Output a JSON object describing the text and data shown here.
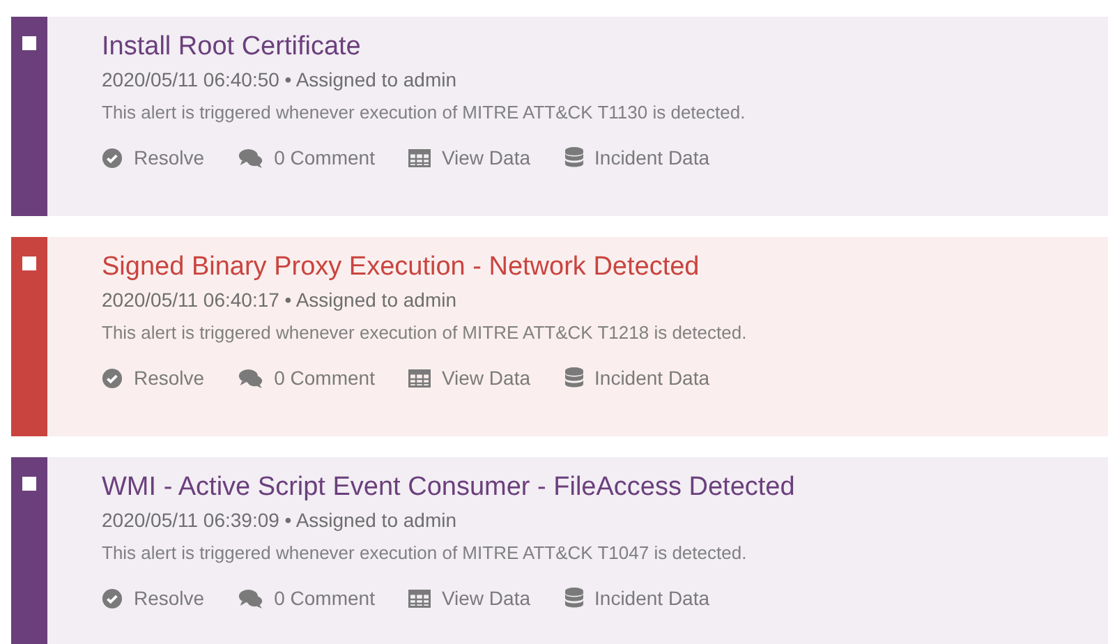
{
  "alerts": [
    {
      "title": "Install Root Certificate",
      "color": "#6b3f7c",
      "checked": false,
      "meta": "2020/05/11 06:40:50 • Assigned to admin",
      "description": "This alert is triggered whenever execution of MITRE ATT&CK T1130 is detected.",
      "actions": [
        {
          "kind": "resolve",
          "label": "Resolve"
        },
        {
          "kind": "comment",
          "label": "0 Comment"
        },
        {
          "kind": "table",
          "label": "View Data"
        },
        {
          "kind": "database",
          "label": "Incident Data"
        }
      ]
    },
    {
      "title": "Signed Binary Proxy Execution - Network Detected",
      "color": "#c9443f",
      "checked": false,
      "meta": "2020/05/11 06:40:17 • Assigned to admin",
      "description": "This alert is triggered whenever execution of MITRE ATT&CK T1218 is detected.",
      "actions": [
        {
          "kind": "resolve",
          "label": "Resolve"
        },
        {
          "kind": "comment",
          "label": "0 Comment"
        },
        {
          "kind": "table",
          "label": "View Data"
        },
        {
          "kind": "database",
          "label": "Incident Data"
        }
      ]
    },
    {
      "title": "WMI - Active Script Event Consumer - FileAccess Detected",
      "color": "#6b3f7c",
      "checked": false,
      "meta": "2020/05/11 06:39:09 • Assigned to admin",
      "description": "This alert is triggered whenever execution of MITRE ATT&CK T1047 is detected.",
      "actions": [
        {
          "kind": "resolve",
          "label": "Resolve"
        },
        {
          "kind": "comment",
          "label": "0 Comment"
        },
        {
          "kind": "table",
          "label": "View Data"
        },
        {
          "kind": "database",
          "label": "Incident Data"
        }
      ]
    }
  ]
}
